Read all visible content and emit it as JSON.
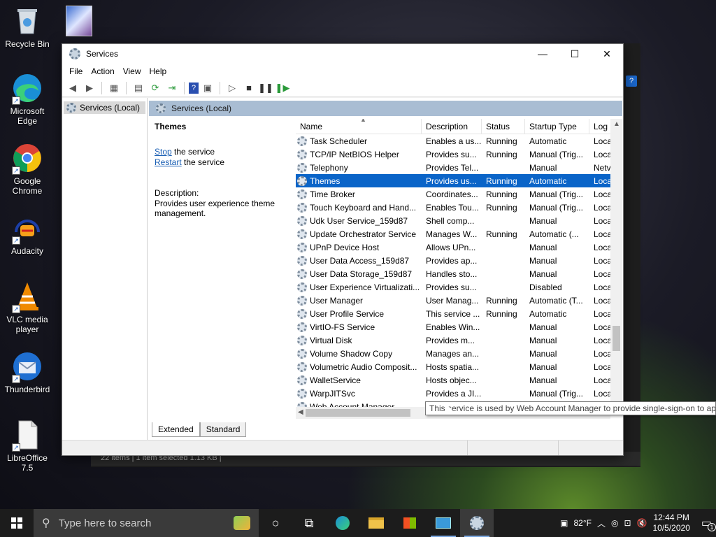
{
  "desktop": {
    "icons": [
      {
        "label": "Recycle Bin",
        "icon": "recycle-bin-icon"
      },
      {
        "label": "Microsoft Edge",
        "icon": "edge-icon"
      },
      {
        "label": "Google Chrome",
        "icon": "chrome-icon"
      },
      {
        "label": "Audacity",
        "icon": "audacity-icon"
      },
      {
        "label": "VLC media player",
        "icon": "vlc-icon"
      },
      {
        "label": "Thunderbird",
        "icon": "thunderbird-icon"
      },
      {
        "label": "LibreOffice 7.5",
        "icon": "libreoffice-icon"
      }
    ]
  },
  "background_window": {
    "status_text": "22 items  |  1 item selected  1.13 KB  |"
  },
  "window": {
    "title": "Services",
    "menu": [
      "File",
      "Action",
      "View",
      "Help"
    ],
    "tree_item": "Services (Local)",
    "pane_header": "Services (Local)",
    "detail": {
      "service_title": "Themes",
      "stop_link": "Stop",
      "stop_rest": " the service",
      "restart_link": "Restart",
      "restart_rest": " the service",
      "description_label": "Description:",
      "description": "Provides user experience theme management."
    },
    "columns": [
      "Name",
      "Description",
      "Status",
      "Startup Type",
      "Log"
    ],
    "rows": [
      {
        "name": "Task Scheduler",
        "desc": "Enables a us...",
        "status": "Running",
        "startup": "Automatic",
        "log": "Loca"
      },
      {
        "name": "TCP/IP NetBIOS Helper",
        "desc": "Provides su...",
        "status": "Running",
        "startup": "Manual (Trig...",
        "log": "Loca"
      },
      {
        "name": "Telephony",
        "desc": "Provides Tel...",
        "status": "",
        "startup": "Manual",
        "log": "Netv"
      },
      {
        "name": "Themes",
        "desc": "Provides us...",
        "status": "Running",
        "startup": "Automatic",
        "log": "Loca"
      },
      {
        "name": "Time Broker",
        "desc": "Coordinates...",
        "status": "Running",
        "startup": "Manual (Trig...",
        "log": "Loca"
      },
      {
        "name": "Touch Keyboard and Hand...",
        "desc": "Enables Tou...",
        "status": "Running",
        "startup": "Manual (Trig...",
        "log": "Loca"
      },
      {
        "name": "Udk User Service_159d87",
        "desc": "Shell comp...",
        "status": "",
        "startup": "Manual",
        "log": "Loca"
      },
      {
        "name": "Update Orchestrator Service",
        "desc": "Manages W...",
        "status": "Running",
        "startup": "Automatic (...",
        "log": "Loca"
      },
      {
        "name": "UPnP Device Host",
        "desc": "Allows UPn...",
        "status": "",
        "startup": "Manual",
        "log": "Loca"
      },
      {
        "name": "User Data Access_159d87",
        "desc": "Provides ap...",
        "status": "",
        "startup": "Manual",
        "log": "Loca"
      },
      {
        "name": "User Data Storage_159d87",
        "desc": "Handles sto...",
        "status": "",
        "startup": "Manual",
        "log": "Loca"
      },
      {
        "name": "User Experience Virtualizati...",
        "desc": "Provides su...",
        "status": "",
        "startup": "Disabled",
        "log": "Loca"
      },
      {
        "name": "User Manager",
        "desc": "User Manag...",
        "status": "Running",
        "startup": "Automatic (T...",
        "log": "Loca"
      },
      {
        "name": "User Profile Service",
        "desc": "This service ...",
        "status": "Running",
        "startup": "Automatic",
        "log": "Loca"
      },
      {
        "name": "VirtIO-FS Service",
        "desc": "Enables Win...",
        "status": "",
        "startup": "Manual",
        "log": "Loca"
      },
      {
        "name": "Virtual Disk",
        "desc": "Provides m...",
        "status": "",
        "startup": "Manual",
        "log": "Loca"
      },
      {
        "name": "Volume Shadow Copy",
        "desc": "Manages an...",
        "status": "",
        "startup": "Manual",
        "log": "Loca"
      },
      {
        "name": "Volumetric Audio Composit...",
        "desc": "Hosts spatia...",
        "status": "",
        "startup": "Manual",
        "log": "Loca"
      },
      {
        "name": "WalletService",
        "desc": "Hosts objec...",
        "status": "",
        "startup": "Manual",
        "log": "Loca"
      },
      {
        "name": "WarpJITSvc",
        "desc": "Provides a JI...",
        "status": "",
        "startup": "Manual (Trig...",
        "log": "Loca"
      },
      {
        "name": "Web Account Manager",
        "desc": "",
        "status": "",
        "startup": "",
        "log": ""
      }
    ],
    "selected_row": 3,
    "tabs": [
      "Extended",
      "Standard"
    ],
    "tooltip": "This service is used by Web Account Manager to provide single-sign-on to app"
  },
  "taskbar": {
    "search_placeholder": "Type here to search",
    "weather": "82°F",
    "time": "12:44 PM",
    "date": "10/5/2020",
    "notification_count": "1"
  },
  "colors": {
    "selection": "#0a64c8",
    "pane_header": "#a9bdd3",
    "link": "#1a5fb4",
    "taskbar": "#1c1c1c"
  }
}
